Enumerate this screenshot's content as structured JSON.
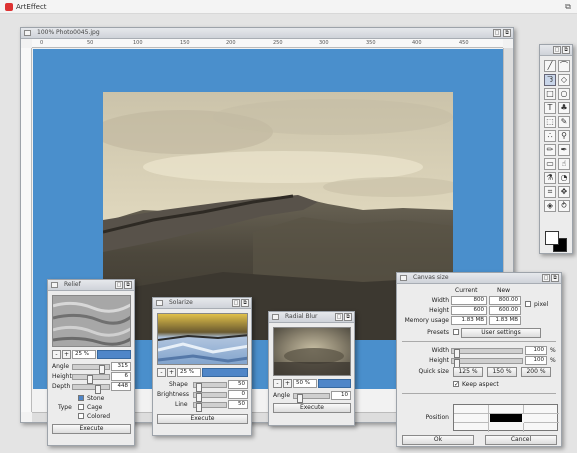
{
  "app": {
    "title": "ArtEffect"
  },
  "image_window": {
    "title": "100% Photo0045.jpg",
    "ruler_labels": [
      "0",
      "50",
      "100",
      "150",
      "200",
      "250",
      "300",
      "350",
      "400",
      "450"
    ]
  },
  "toolbox": {
    "tools": [
      "line-tool",
      "curve-tool",
      "lasso-tool",
      "fill-tool",
      "rect-tool",
      "ellipse-tool",
      "text-tool",
      "stamp-tool",
      "select-tool",
      "brush-tool",
      "spray-tool",
      "magnify-tool",
      "pencil-tool",
      "pen-tool",
      "eraser-tool",
      "smudge-tool",
      "dropper-tool",
      "clone-tool",
      "crop-tool",
      "move-tool",
      "filter-tool",
      "warp-tool"
    ]
  },
  "relief": {
    "title": "Relief",
    "zoom": "25 %",
    "params": [
      {
        "label": "Angle",
        "value": "315"
      },
      {
        "label": "Height",
        "value": "6"
      },
      {
        "label": "Depth",
        "value": "448"
      }
    ],
    "type_label": "Type",
    "options": [
      "Stone",
      "Cage",
      "Colored"
    ],
    "execute": "Execute"
  },
  "solarize": {
    "title": "Solarize",
    "zoom": "25 %",
    "params": [
      {
        "label": "Shape",
        "value": "50"
      },
      {
        "label": "Brightness",
        "value": "0"
      },
      {
        "label": "Line",
        "value": "50"
      }
    ],
    "execute": "Execute"
  },
  "radial": {
    "title": "Radial Blur",
    "zoom": "50 %",
    "params": [
      {
        "label": "Angle",
        "value": "10"
      }
    ],
    "execute": "Execute"
  },
  "canvas_size": {
    "title": "Canvas size",
    "col_current": "Current",
    "col_new": "New",
    "width_label": "Width",
    "height_label": "Height",
    "memory_label": "Memory usage",
    "width_current": "800",
    "width_new": "800.00",
    "height_current": "600",
    "height_new": "600.00",
    "memory_current": "1.83 MB",
    "memory_new": "1.83 MB",
    "unit": "pixel",
    "presets_label": "Presets",
    "presets_value": "User settings",
    "width_pct": "100",
    "height_pct": "100",
    "pct_unit": "%",
    "quick_label": "Quick size",
    "quick": [
      "125 %",
      "150 %",
      "200 %"
    ],
    "keep_aspect": "Keep aspect",
    "position_label": "Position",
    "ok": "Ok",
    "cancel": "Cancel"
  },
  "colors": {
    "canvas_blue": "#4a8fcc",
    "accent": "#4f86c8"
  }
}
